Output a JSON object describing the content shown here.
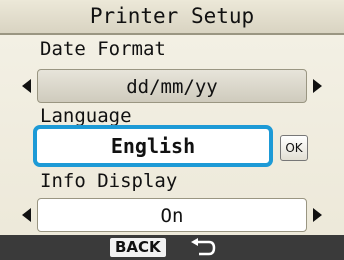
{
  "title": "Printer Setup",
  "date_format": {
    "label": "Date Format",
    "value": "dd/mm/yy"
  },
  "language": {
    "label": "Language",
    "value": "English",
    "ok_label": "OK"
  },
  "info_display": {
    "label": "Info Display",
    "value": "On"
  },
  "footer": {
    "back_label": "BACK",
    "back_icon": "return-arrow-icon"
  },
  "colors": {
    "selection_highlight": "#1d9ad6",
    "footer_background": "#3a3a3a"
  }
}
